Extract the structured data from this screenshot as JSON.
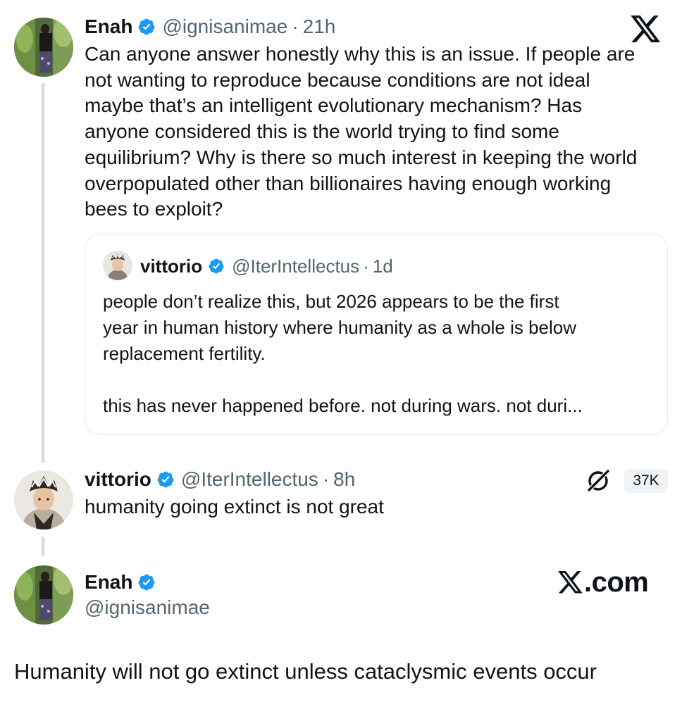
{
  "brand_color": "#1d9bf0",
  "original_tweet": {
    "author_name": "Enah",
    "handle": "@ignisanimae",
    "separator": "·",
    "time": "21h",
    "lines": [
      "Can anyone answer honestly why this is an issue. If people are",
      "not wanting to reproduce because conditions are not ideal",
      "maybe that’s an intelligent evolutionary mechanism? Has",
      "anyone considered this is the world trying to find some",
      "equilibrium? Why is there so much interest in keeping the world",
      "overpopulated other than billionaires having enough working",
      "bees to exploit?"
    ]
  },
  "quoted_tweet": {
    "author_name": "vittorio",
    "handle": "@IterIntellectus",
    "separator": "·",
    "time": "1d",
    "lines": [
      "people don’t realize this, but 2026 appears to be the first",
      "year in human history where humanity as a whole is below",
      "replacement fertility.",
      "",
      "this has never happened before. not during wars. not duri..."
    ]
  },
  "reply_tweet": {
    "author_name": "vittorio",
    "handle": "@IterIntellectus",
    "separator": "·",
    "time": "8h",
    "text": "humanity going extinct is not great",
    "views": "37K"
  },
  "profile_card": {
    "author_name": "Enah",
    "handle": "@ignisanimae",
    "site_label": ".com"
  },
  "caption": "Humanity will not go extinct unless cataclysmic events occur",
  "icons": {
    "verified": "verified-badge-icon",
    "x_logo": "x-logo-icon",
    "grok": "grok-icon"
  }
}
